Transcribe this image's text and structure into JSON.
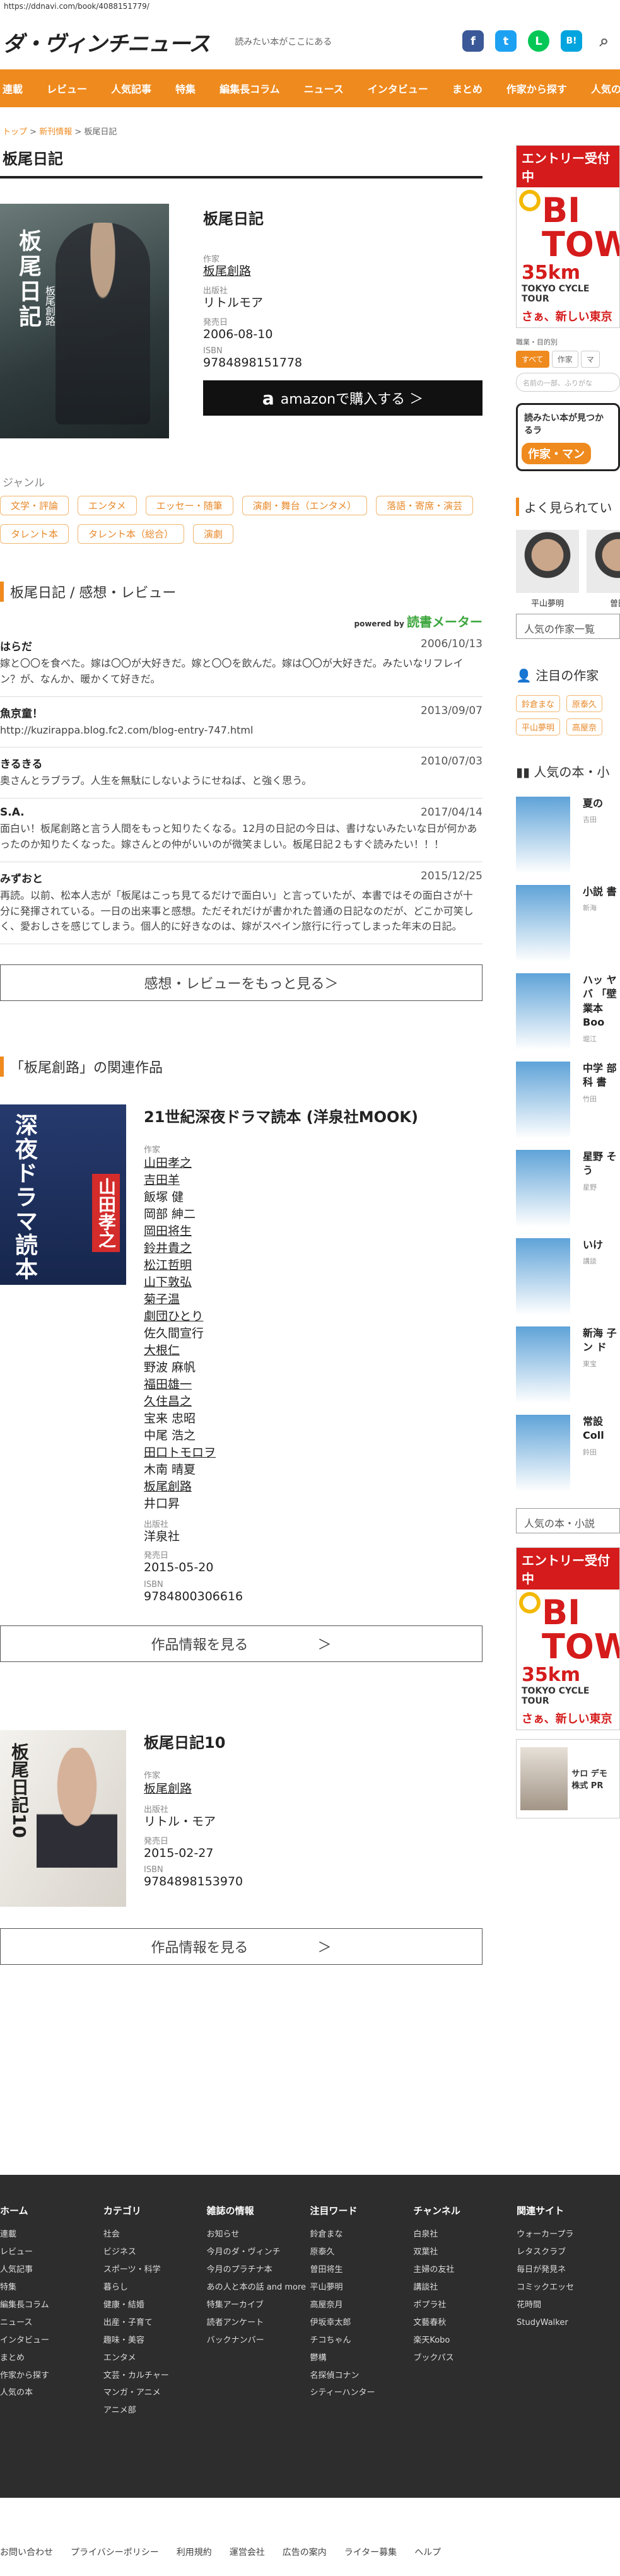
{
  "url": "https://ddnavi.com/book/4088151779/",
  "site": {
    "logo": "ダ・ヴィンチニュース",
    "tagline": "読みたい本がここにある"
  },
  "social": {
    "fb": "f",
    "tw": "t",
    "line": "L",
    "hatena": "B!",
    "search": "⌕"
  },
  "nav": [
    "連載",
    "レビュー",
    "人気記事",
    "特集",
    "編集長コラム",
    "ニュース",
    "インタビュー",
    "まとめ",
    "作家から探す",
    "人気の本"
  ],
  "breadcrumb": {
    "top": "トップ",
    "sep": ">",
    "new": "新刊情報",
    "current": "板尾日記"
  },
  "title": "板尾日記",
  "book": {
    "cover_title": "板尾日記",
    "cover_author": "板尾創路",
    "name": "板尾日記",
    "author_label": "作家",
    "author": "板尾創路",
    "publisher_label": "出版社",
    "publisher": "リトルモア",
    "date_label": "発売日",
    "date": "2006-08-10",
    "isbn_label": "ISBN",
    "isbn": "9784898151778",
    "amazon": "amazonで購入する ＞",
    "amazon_a": "a"
  },
  "genre": {
    "heading": "ジャンル",
    "tags": [
      "文学・評論",
      "エンタメ",
      "エッセー・随筆",
      "演劇・舞台（エンタメ）",
      "落語・寄席・演芸",
      "タレント本",
      "タレント本（総合）",
      "演劇"
    ]
  },
  "reviews": {
    "heading": "板尾日記 / 感想・レビュー",
    "powered_by": "powered by",
    "dokusho": "読書メーター",
    "items": [
      {
        "user": "はらだ",
        "date": "2006/10/13",
        "body": "嫁と〇〇を食べた。嫁は〇〇が大好きだ。嫁と〇〇を飲んだ。嫁は〇〇が大好きだ。みたいなリフレイン？が、なんか、暖かくて好きだ。"
      },
      {
        "user": "魚京童！",
        "date": "2013/09/07",
        "body": "http://kuzirappa.blog.fc2.com/blog-entry-747.html"
      },
      {
        "user": "きるきる",
        "date": "2010/07/03",
        "body": "奥さんとラブラブ。人生を無駄にしないようにせねば、と強く思う。"
      },
      {
        "user": "S.A.",
        "date": "2017/04/14",
        "body": "面白い！板尾創路と言う人間をもっと知りたくなる。12月の日記の今日は、書けないみたいな日が何かあったのか知りたくなった。嫁さんとの仲がいいのが微笑ましい。板尾日記２もすぐ読みたい！！！"
      },
      {
        "user": "みずおと",
        "date": "2015/12/25",
        "body": "再読。以前、松本人志が「板尾はこっち見てるだけで面白い」と言っていたが、本書ではその面白さが十分に発揮されている。一日の出来事と感想。ただそれだけが書かれた普通の日記なのだが、どこか可笑しく、愛おしさを感じてしまう。個人的に好きなのは、嫁がスペイン旅行に行ってしまった年末の日記。"
      }
    ],
    "more": "感想・レビューをもっと見る＞"
  },
  "related": {
    "heading_pre": "「板尾創路」",
    "heading_post": "の関連作品",
    "items": [
      {
        "cover_title": "深夜ドラマ読本",
        "cover_name": "山田孝之",
        "title": "21世紀深夜ドラマ読本 (洋泉社MOOK)",
        "author_label": "作家",
        "authors": [
          {
            "n": "山田孝之",
            "u": true
          },
          {
            "n": "吉田羊",
            "u": true
          },
          {
            "n": "飯塚 健",
            "u": false
          },
          {
            "n": "岡部 紳二",
            "u": false
          },
          {
            "n": "岡田将生",
            "u": true
          },
          {
            "n": "鈴井貴之",
            "u": true
          },
          {
            "n": "松江哲明",
            "u": true
          },
          {
            "n": "山下敦弘",
            "u": true
          },
          {
            "n": "菊子温",
            "u": true
          },
          {
            "n": "劇団ひとり",
            "u": true
          },
          {
            "n": "佐久間宣行",
            "u": false
          },
          {
            "n": "大根仁",
            "u": true
          },
          {
            "n": "野波 麻帆",
            "u": false
          },
          {
            "n": "福田雄一",
            "u": true
          },
          {
            "n": "久住昌之",
            "u": true
          },
          {
            "n": "宝来 忠昭",
            "u": false
          },
          {
            "n": "中尾 浩之",
            "u": false
          },
          {
            "n": "田口トモロヲ",
            "u": true
          },
          {
            "n": "木南 晴夏",
            "u": false
          },
          {
            "n": "板尾創路",
            "u": true
          },
          {
            "n": "井口昇",
            "u": false
          }
        ],
        "publisher_label": "出版社",
        "publisher": "洋泉社",
        "date_label": "発売日",
        "date": "2015-05-20",
        "isbn_label": "ISBN",
        "isbn": "9784800306616",
        "button": "作品情報を見る",
        "arrow": "＞"
      },
      {
        "cover_title": "板尾日記10",
        "title": "板尾日記10",
        "author_label": "作家",
        "authors": [
          {
            "n": "板尾創路",
            "u": true
          }
        ],
        "publisher_label": "出版社",
        "publisher": "リトル・モア",
        "date_label": "発売日",
        "date": "2015-02-27",
        "isbn_label": "ISBN",
        "isbn": "9784898153970",
        "button": "作品情報を見る",
        "arrow": "＞"
      }
    ]
  },
  "sidebar": {
    "ad_tour": {
      "band": "エントリー受付中",
      "big": "BI TOW",
      "km": "35km",
      "sub": "TOKYO CYCLE TOUR",
      "slogan": "さぁ、新しい東京の"
    },
    "search": {
      "label": "職業・目的別",
      "tabs": [
        "すべて",
        "作家",
        "マ"
      ],
      "placeholder": "名前の一部、ふりがな"
    },
    "ad_search": {
      "text": "読みたい本が見つかるラ",
      "btn": "作家・マン"
    },
    "popular_authors": {
      "heading": "よく見られてい",
      "authors": [
        "平山夢明",
        "曽田"
      ],
      "more": "人気の作家一覧"
    },
    "featured": {
      "heading": "注目の作家",
      "tags": [
        "鈴倉まな",
        "原泰久",
        "平山夢明",
        "高屋奈"
      ]
    },
    "popular_books": {
      "heading": "人気の本・小",
      "items": [
        {
          "t": "夏の",
          "p": "吉田"
        },
        {
          "t": "小説 書",
          "p": "新海"
        },
        {
          "t": "ハッ ヤバ 「壁 業本 Boo",
          "p": "堀江"
        },
        {
          "t": "中学 部科 書",
          "p": "竹田"
        },
        {
          "t": "星野 そう",
          "p": "星野"
        },
        {
          "t": "いけ",
          "p": "講談"
        },
        {
          "t": "新海 子 ン ド",
          "p": "東宝"
        },
        {
          "t": "常設 Coll",
          "p": "鈴田"
        }
      ],
      "more": "人気の本・小説"
    },
    "ad_small": {
      "text": "サロ デモ 株式 PR"
    }
  },
  "footer": {
    "cols": [
      {
        "h": "ホーム",
        "items": [
          "連載",
          "レビュー",
          "人気記事",
          "特集",
          "編集長コラム",
          "ニュース",
          "インタビュー",
          "まとめ",
          "作家から探す",
          "人気の本"
        ]
      },
      {
        "h": "カテゴリ",
        "items": [
          "社会",
          "ビジネス",
          "スポーツ・科学",
          "暮らし",
          "健康・結婚",
          "出産・子育て",
          "趣味・美容",
          "エンタメ",
          "文芸・カルチャー",
          "マンガ・アニメ",
          "アニメ部"
        ]
      },
      {
        "h": "雑誌の情報",
        "items": [
          "お知らせ",
          "今月のダ・ヴィンチ",
          "今月のプラチナ本",
          "あの人と本の話 and more",
          "特集アーカイブ",
          "読者アンケート",
          "バックナンバー"
        ]
      },
      {
        "h": "注目ワード",
        "items": [
          "鈴倉まな",
          "原泰久",
          "曽田将生",
          "平山夢明",
          "高屋奈月",
          "伊坂幸太郎",
          "チコちゃん",
          "鬱構",
          "名探偵コナン",
          "シティーハンター"
        ]
      },
      {
        "h": "チャンネル",
        "items": [
          "白泉社",
          "双葉社",
          "主婦の友社",
          "講談社",
          "ポプラ社",
          "文藝春秋",
          "楽天Kobo",
          "ブックパス"
        ]
      },
      {
        "h": "関連サイト",
        "items": [
          "ウォーカープラ",
          "レタスクラブ",
          "毎日が発見ネ",
          "コミックエッセ",
          "花時間",
          "StudyWalker"
        ]
      }
    ],
    "bottom": [
      "お問い合わせ",
      "プライバシーポリシー",
      "利用規約",
      "運営会社",
      "広告の案内",
      "ライター募集",
      "ヘルプ"
    ]
  }
}
